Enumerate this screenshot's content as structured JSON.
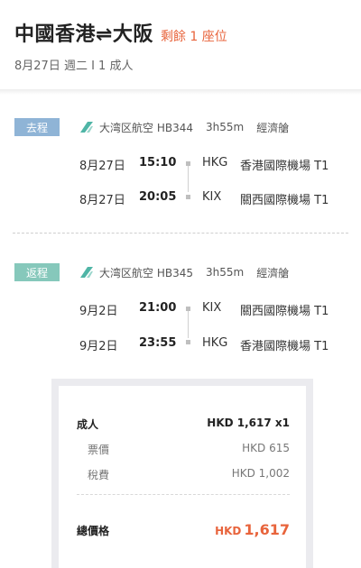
{
  "header": {
    "title": "中國香港⇌大阪",
    "seats_left": "剩餘 1 座位",
    "subtitle": "8月27日 週二 I 1 成人"
  },
  "outbound": {
    "tag": "去程",
    "airline_icon": "airline-tail-icon",
    "airline": "大湾区航空 HB344",
    "duration": "3h55m",
    "cabin": "經濟艙",
    "legs": [
      {
        "date": "8月27日",
        "time": "15:10",
        "code": "HKG",
        "airport": "香港國際機場 T1"
      },
      {
        "date": "8月27日",
        "time": "20:05",
        "code": "KIX",
        "airport": "關西國際機場 T1"
      }
    ]
  },
  "return": {
    "tag": "返程",
    "airline_icon": "airline-tail-icon",
    "airline": "大湾区航空 HB345",
    "duration": "3h55m",
    "cabin": "經濟艙",
    "legs": [
      {
        "date": "9月2日",
        "time": "21:00",
        "code": "KIX",
        "airport": "關西國際機場 T1"
      },
      {
        "date": "9月2日",
        "time": "23:55",
        "code": "HKG",
        "airport": "香港國際機場 T1"
      }
    ]
  },
  "price": {
    "adult_label": "成人",
    "adult_value": "HKD 1,617 x1",
    "fare_label": "票價",
    "fare_value": "HKD 615",
    "tax_label": "稅費",
    "tax_value": "HKD 1,002",
    "total_label": "總價格",
    "total_currency": "HKD",
    "total_value": "1,617"
  },
  "colors": {
    "accent": "#e8643c",
    "outbound_tag": "#8fb4d6",
    "return_tag": "#86c8bb",
    "airline_icon": "#4fb5a6"
  }
}
